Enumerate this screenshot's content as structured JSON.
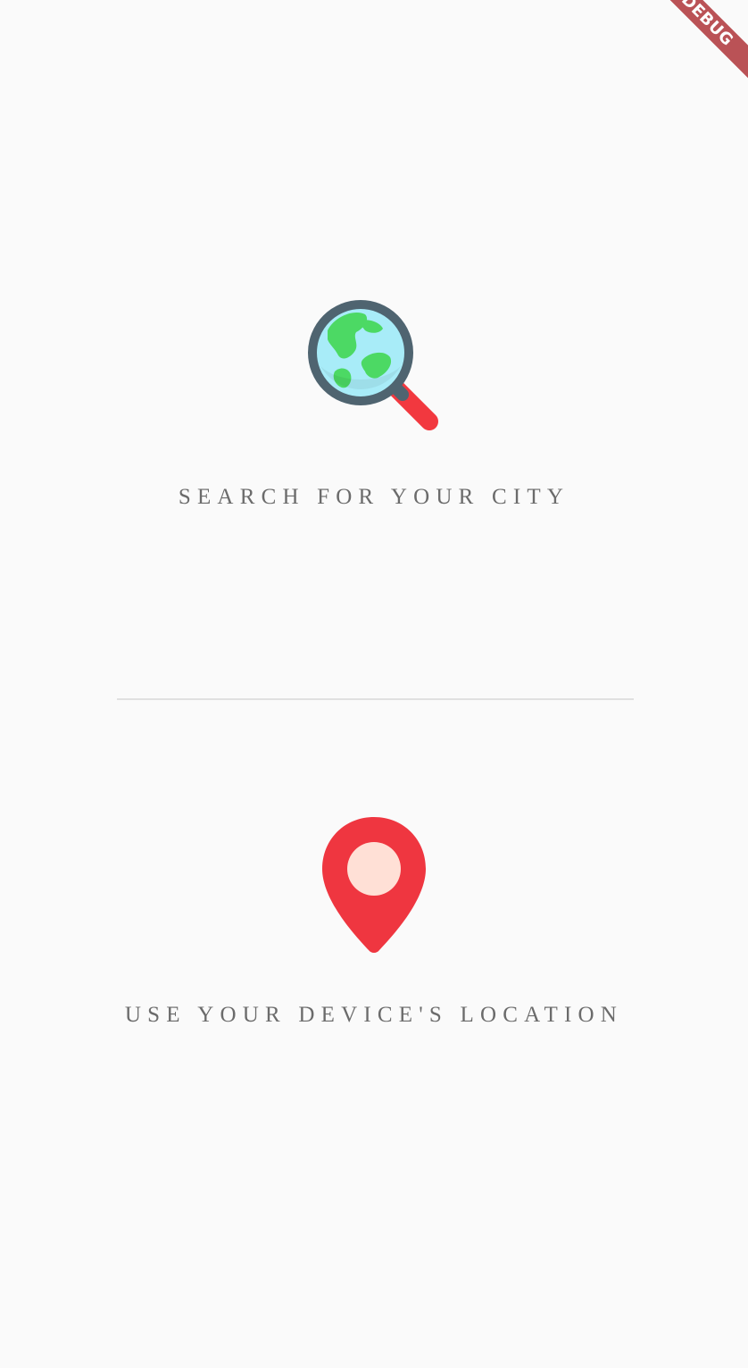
{
  "search_option": {
    "label": "SEARCH FOR YOUR CITY",
    "icon": "globe-magnifier-icon"
  },
  "location_option": {
    "label": "USE YOUR DEVICE'S LOCATION",
    "icon": "map-pin-icon"
  },
  "debug_banner": {
    "label": "DEBUG"
  },
  "colors": {
    "background": "#fafafa",
    "label": "#6b6b6b",
    "divider": "#e0e0e0",
    "pin_red": "#ef3640",
    "pin_inner": "#ffe0d6",
    "magnifier_ring": "#4f6470",
    "globe_water": "#a8ecf8",
    "globe_land": "#4cd964",
    "handle_red": "#f2383f",
    "banner": "#b0353a"
  }
}
